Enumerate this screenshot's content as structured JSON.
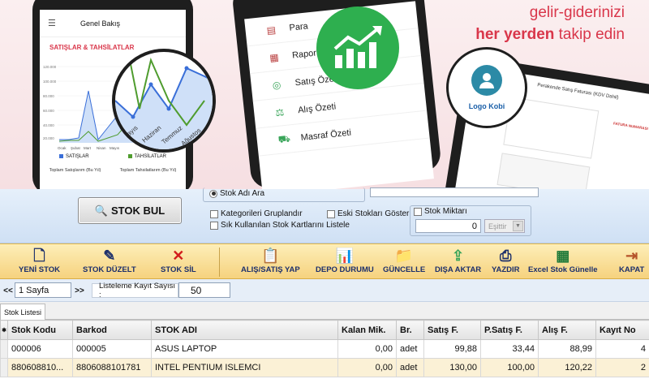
{
  "banner": {
    "phone1": {
      "title": "Genel Bakış",
      "chart_title": "SATIŞLAR & TAHSİLATLAR",
      "legend": [
        "SATIŞLAR",
        "TAHSİLATLAR"
      ],
      "totals": [
        "Toplam Satışlarım (Bu Yıl)",
        "Toplam Tahsilatlarım (Bu Yıl)"
      ],
      "y_ticks": [
        "120.000",
        "100.000",
        "80.000",
        "60.000",
        "40.000",
        "20.000"
      ],
      "months": [
        "Ocak",
        "Şubat",
        "Mart",
        "Nisan",
        "Mayıs",
        "Haziran",
        "Temmuz",
        "Ağustos",
        "Eylül",
        "Ekim"
      ],
      "zoom_months": [
        "Mayıs",
        "Haziran",
        "Temmuz",
        "Ağustos"
      ]
    },
    "phone2": {
      "menu": [
        {
          "label": "Para",
          "icon": "wallet-icon"
        },
        {
          "label": "Raporlar",
          "icon": "report-icon"
        },
        {
          "label": "Satış Özeti",
          "icon": "coins-icon"
        },
        {
          "label": "Alış Özeti",
          "icon": "scale-icon"
        },
        {
          "label": "Masraf Özeti",
          "icon": "cart-icon"
        }
      ]
    },
    "slogan_line1": "gelir-giderinizi",
    "slogan_bold": "her yerden",
    "slogan_rest": " takip edin",
    "tablet": {
      "logo_label": "Logo Kobi",
      "header": "Perakende Satış Faturası (KDV Dahil)",
      "badge": "FATURA NUMARASI"
    }
  },
  "search": {
    "button_label": "STOK BUL",
    "radio_label": "Stok Adı Ara",
    "opt_grouped": "Kategorileri Gruplandır",
    "opt_old": "Eski Stokları Göster",
    "opt_frequent": "Sık Kullanılan Stok Kartlarını Listele",
    "opt_qty": "Stok Miktarı",
    "qty_value": "0",
    "compare_value": "Eşittir"
  },
  "toolbar": [
    {
      "label": "YENİ STOK",
      "icon": "new-document-icon"
    },
    {
      "label": "STOK DÜZELT",
      "icon": "edit-document-icon"
    },
    {
      "label": "STOK SİL",
      "icon": "delete-icon"
    },
    {
      "label": "ALIŞ/SATIŞ YAP",
      "icon": "clipboard-icon"
    },
    {
      "label": "DEPO DURUMU",
      "icon": "warehouse-chart-icon"
    },
    {
      "label": "GÜNCELLE",
      "icon": "folder-refresh-icon"
    },
    {
      "label": "DIŞA AKTAR",
      "icon": "export-icon"
    },
    {
      "label": "YAZDIR",
      "icon": "printer-icon"
    },
    {
      "label": "Excel Stok Günelle",
      "icon": "excel-icon"
    },
    {
      "label": "KAPAT",
      "icon": "exit-icon"
    }
  ],
  "pager": {
    "first": "<<",
    "page": "1 Sayfa",
    "next": ">>",
    "count_label": "Listeleme Kayıt Sayısı :",
    "count_value": "50"
  },
  "tab_label": "Stok Listesi",
  "grid": {
    "columns": [
      "Stok Kodu",
      "Barkod",
      "STOK ADI",
      "Kalan Mik.",
      "Br.",
      "Satış F.",
      "P.Satış F.",
      "Alış F.",
      "Kayıt No"
    ],
    "rows": [
      [
        "000006",
        "000005",
        "ASUS LAPTOP",
        "0,00",
        "adet",
        "99,88",
        "33,44",
        "88,99",
        "4"
      ],
      [
        "880608810...",
        "8806088101781",
        "INTEL PENTIUM ISLEMCI",
        "0,00",
        "adet",
        "130,00",
        "100,00",
        "120,22",
        "2"
      ]
    ]
  },
  "colors": {
    "brand_red": "#d9364a",
    "growth_green": "#2eaf4f",
    "series_sales": "#3a6fd8",
    "series_collections": "#4f9c2e"
  }
}
